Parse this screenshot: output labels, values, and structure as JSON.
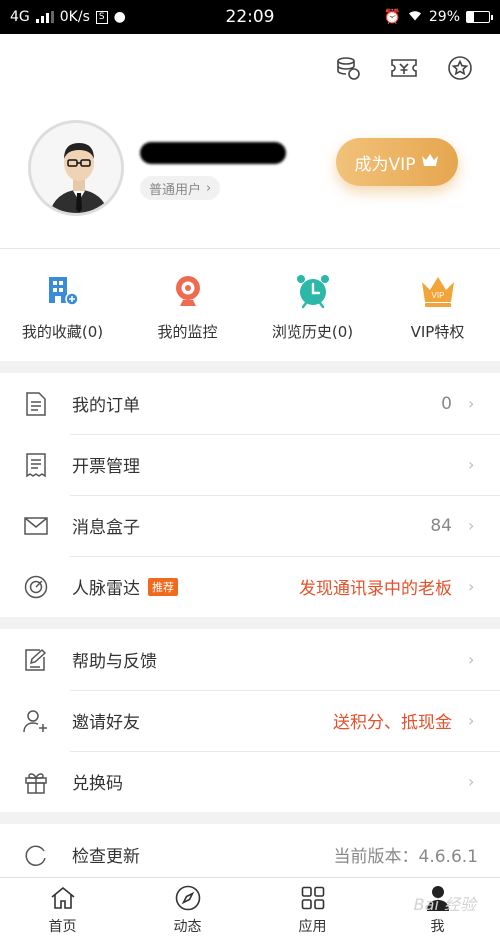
{
  "status_bar": {
    "network": "4G",
    "speed": "0K/s",
    "time": "22:09",
    "battery": "29%"
  },
  "header": {
    "top_icons": [
      "coins-icon",
      "ticket-icon",
      "star-icon"
    ],
    "user_badge": "普通用户",
    "vip_button": "成为VIP"
  },
  "quick_actions": [
    {
      "label": "我的收藏(0)",
      "icon": "building-icon",
      "color": "#3b8bdb"
    },
    {
      "label": "我的监控",
      "icon": "webcam-icon",
      "color": "#ef6b4f"
    },
    {
      "label": "浏览历史(0)",
      "icon": "alarm-clock-icon",
      "color": "#2bb8a8"
    },
    {
      "label": "VIP特权",
      "icon": "crown-icon",
      "color": "#f1a43a"
    }
  ],
  "menu_group1": [
    {
      "label": "我的订单",
      "value": "0",
      "icon": "document-icon"
    },
    {
      "label": "开票管理",
      "value": "",
      "icon": "receipt-icon"
    },
    {
      "label": "消息盒子",
      "value": "84",
      "icon": "mail-icon"
    },
    {
      "label": "人脉雷达",
      "tag": "推荐",
      "value": "发现通讯录中的老板",
      "icon": "radar-icon"
    }
  ],
  "menu_group2": [
    {
      "label": "帮助与反馈",
      "value": "",
      "icon": "feedback-icon"
    },
    {
      "label": "邀请好友",
      "value": "送积分、抵现金",
      "icon": "add-user-icon"
    },
    {
      "label": "兑换码",
      "value": "",
      "icon": "gift-icon"
    }
  ],
  "menu_group3": [
    {
      "label": "检查更新",
      "value": "当前版本：4.6.6.1",
      "icon": "refresh-icon"
    }
  ],
  "tab_bar": [
    {
      "label": "首页",
      "icon": "home-icon"
    },
    {
      "label": "动态",
      "icon": "compass-icon"
    },
    {
      "label": "应用",
      "icon": "grid-icon"
    },
    {
      "label": "我",
      "icon": "user-icon"
    }
  ],
  "watermark": "Bai 经验"
}
